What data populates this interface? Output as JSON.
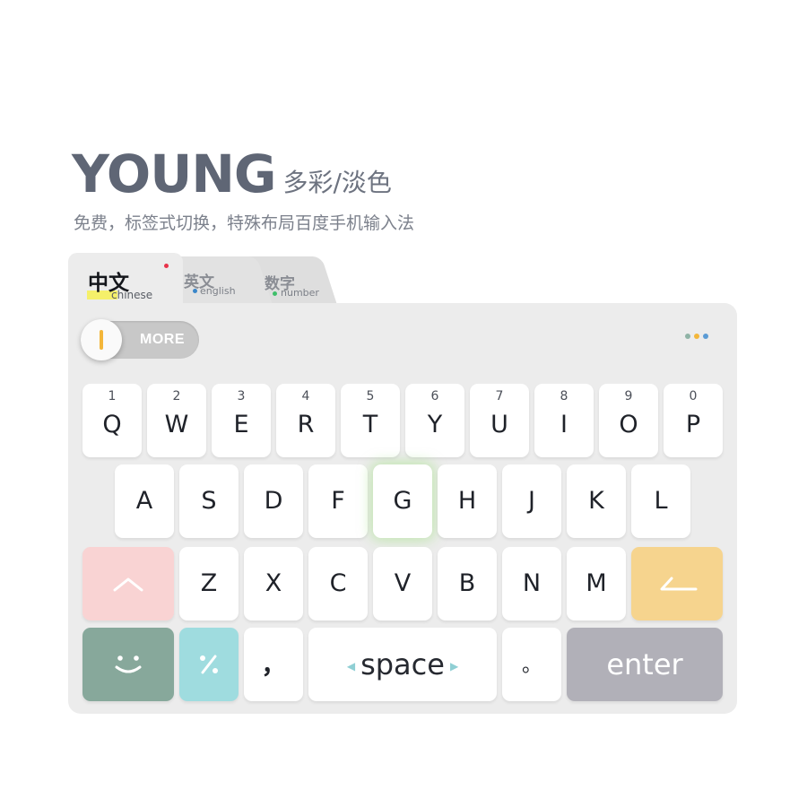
{
  "header": {
    "title": "YOUNG",
    "subtitle": "多彩/淡色",
    "description": "免费，标签式切换，特殊布局百度手机输入法"
  },
  "tabs": [
    {
      "label": "中文",
      "sub": "chinese",
      "active": true,
      "marker_color": "#e8334a",
      "highlight_color": "#f5f06a"
    },
    {
      "label": "英文",
      "sub": "english",
      "active": false,
      "marker_color": "#3a86c9"
    },
    {
      "label": "数字",
      "sub": "number",
      "active": false,
      "marker_color": "#3fbf6a"
    }
  ],
  "toolbar": {
    "more_label": "MORE",
    "toggle_accent": "#f3b63a",
    "menu_dots": [
      "#8fb3a6",
      "#f3b63a",
      "#5b9bd5"
    ]
  },
  "keyboard": {
    "row1": [
      {
        "num": "1",
        "letter": "Q"
      },
      {
        "num": "2",
        "letter": "W"
      },
      {
        "num": "3",
        "letter": "E"
      },
      {
        "num": "4",
        "letter": "R"
      },
      {
        "num": "5",
        "letter": "T"
      },
      {
        "num": "6",
        "letter": "Y"
      },
      {
        "num": "7",
        "letter": "U"
      },
      {
        "num": "8",
        "letter": "I"
      },
      {
        "num": "9",
        "letter": "O"
      },
      {
        "num": "0",
        "letter": "P"
      }
    ],
    "row2": [
      "A",
      "S",
      "D",
      "F",
      "G",
      "H",
      "J",
      "K",
      "L"
    ],
    "row3": [
      "Z",
      "X",
      "C",
      "V",
      "B",
      "N",
      "M"
    ],
    "highlighted_key": "G",
    "comma": "，",
    "space_label": "space",
    "period": "。",
    "enter_label": "enter",
    "colors": {
      "shift": "#f9d3d3",
      "backspace": "#f6d48e",
      "emoji": "#87a89b",
      "symbols": "#9fdcdf",
      "enter": "#b1b0b8"
    }
  }
}
